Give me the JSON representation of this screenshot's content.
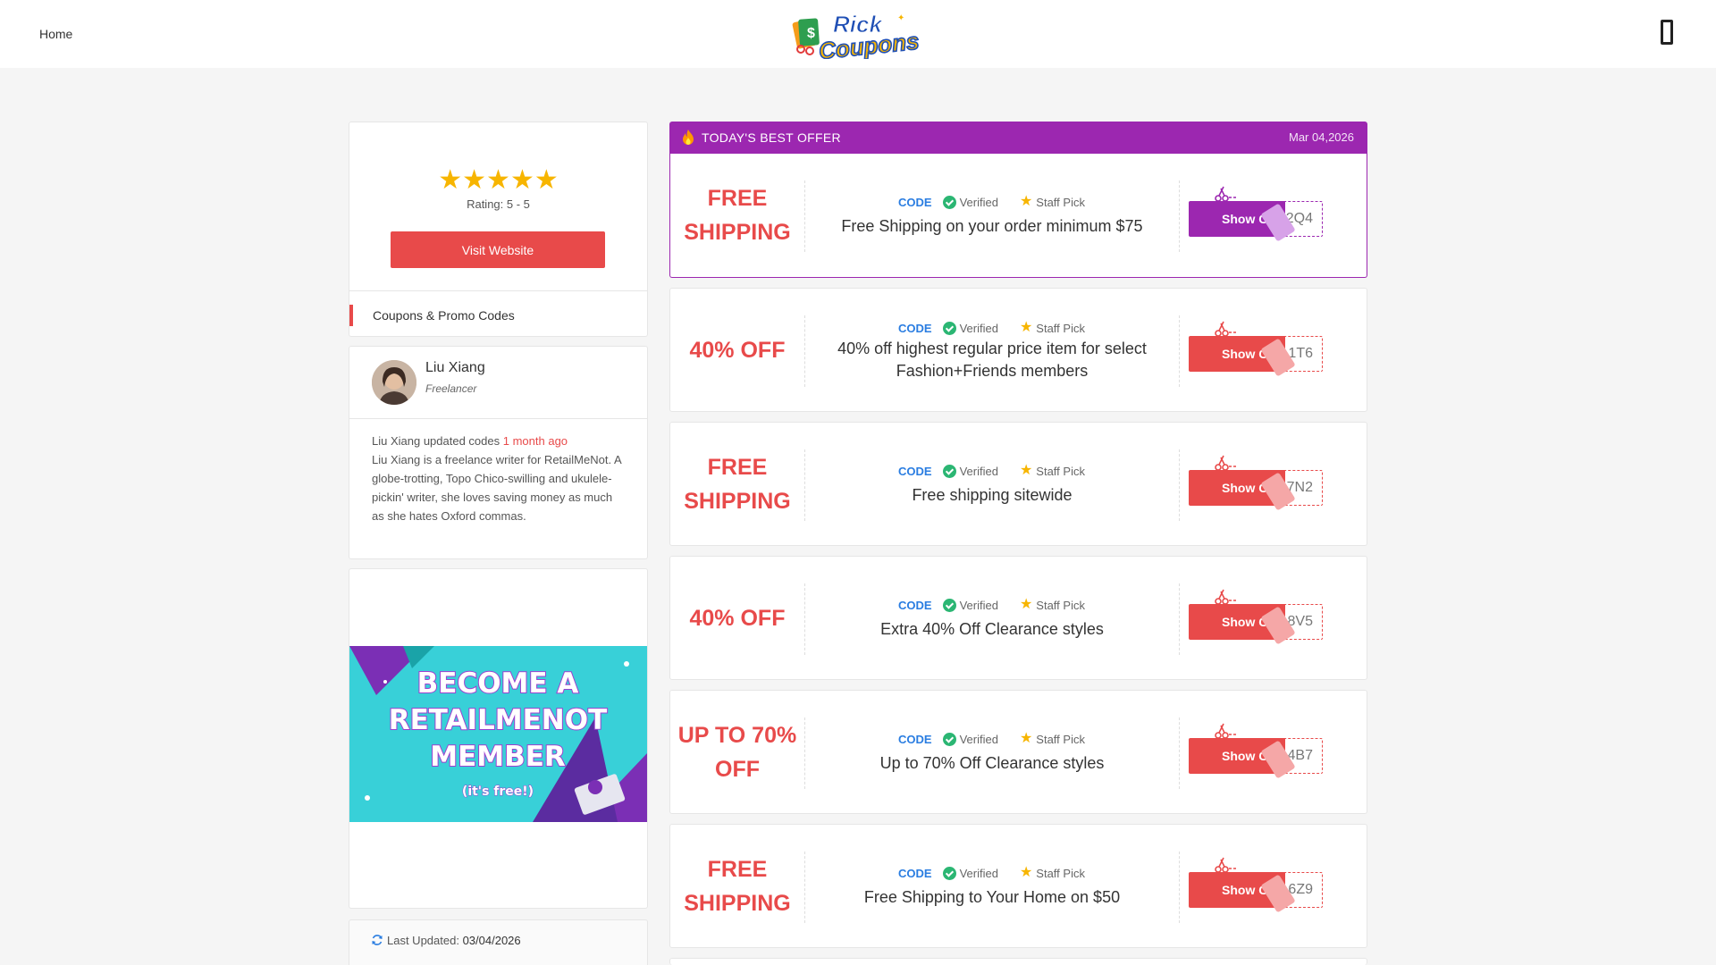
{
  "nav": {
    "home_label": "Home",
    "logo_alt": "Rick Coupons",
    "menu_icon": "menu-icon"
  },
  "sidebar": {
    "rating_stars": 5,
    "rating_text": "Rating: 5 - 5",
    "visit_label": "Visit Website",
    "tab_label": "Coupons & Promo Codes"
  },
  "author": {
    "name": "Liu Xiang",
    "role": "Freelancer",
    "updated_prefix": "Liu Xiang updated codes",
    "updated_ago": "1 month ago",
    "bio": "Liu Xiang is a freelance writer for RetailMeNot. A globe-trotting, Topo Chico-swilling and ukulele-pickin' writer, she loves saving money as much as she hates Oxford commas."
  },
  "ad": {
    "line1": "BECOME A",
    "line2": "RETAILMENOT",
    "line3": "MEMBER",
    "line4": "(it's free!)"
  },
  "last_updated": {
    "label": "Last Updated:",
    "date": "03/04/2026"
  },
  "best_offer": {
    "title": "TODAY'S BEST OFFER",
    "date": "Mar 04,2026"
  },
  "labels": {
    "code": "CODE",
    "verified": "Verified",
    "staff_pick": "Staff Pick",
    "show_code": "Show Code"
  },
  "offers": [
    {
      "discount": "FREE SHIPPING",
      "description": "Free Shipping on your order minimum $75",
      "code_tail": "2Q4"
    },
    {
      "discount": "40% OFF",
      "description": "40% off highest regular price item for select Fashion+Friends members",
      "code_tail": "1T6"
    },
    {
      "discount": "FREE SHIPPING",
      "description": "Free shipping sitewide",
      "code_tail": "7N2"
    },
    {
      "discount": "40% OFF",
      "description": "Extra 40% Off Clearance styles",
      "code_tail": "8V5"
    },
    {
      "discount": "UP TO 70% OFF",
      "description": "Up to 70% Off Clearance styles",
      "code_tail": "4B7"
    },
    {
      "discount": "FREE SHIPPING",
      "description": "Free Shipping to Your Home on $50",
      "code_tail": "6Z9"
    }
  ],
  "colors": {
    "accent": "#e84a4a",
    "best": "#9c27b0",
    "code_blue": "#2a7de1",
    "verified": "#2bb673",
    "star": "#f7b500"
  }
}
